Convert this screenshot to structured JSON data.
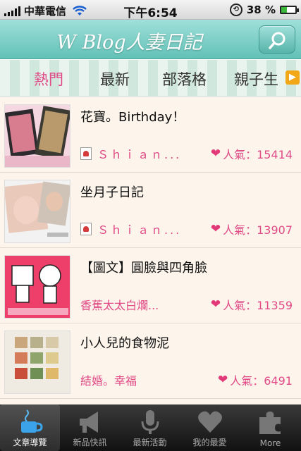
{
  "status_bar": {
    "carrier": "中華電信",
    "time": "下午6:54",
    "battery_percent": "38 %",
    "battery_level": 0.38
  },
  "header": {
    "title": "W Blog人妻日記",
    "search_icon": "search-icon"
  },
  "tabs": [
    {
      "label": "熱門",
      "active": true
    },
    {
      "label": "最新",
      "active": false
    },
    {
      "label": "部落格",
      "active": false
    },
    {
      "label": "親子生",
      "active": false
    }
  ],
  "posts": [
    {
      "title": "花寶。Birthday！",
      "author": "Ｓｈｉａｎ...",
      "popularity": "人氣：15414"
    },
    {
      "title": "坐月子日記",
      "author": "Ｓｈｉａｎ...",
      "popularity": "人氣：13907"
    },
    {
      "title": "【圖文】圓臉與四角臉",
      "author": "香蕉太太白爛...",
      "popularity": "人氣：11359"
    },
    {
      "title": "小人兒的食物泥",
      "author": "結婚。幸福",
      "popularity": "人氣：6491"
    }
  ],
  "tabbar": [
    {
      "label": "文章導覽",
      "icon": "cup-icon"
    },
    {
      "label": "新品快訊",
      "icon": "megaphone-icon"
    },
    {
      "label": "最新活動",
      "icon": "microphone-icon"
    },
    {
      "label": "我的最愛",
      "icon": "heart-icon"
    },
    {
      "label": "More",
      "icon": "puzzle-icon"
    }
  ],
  "colors": {
    "accent_pink": "#e04a86",
    "header_teal": "#62c1b6",
    "list_background": "#fdf5ec"
  }
}
